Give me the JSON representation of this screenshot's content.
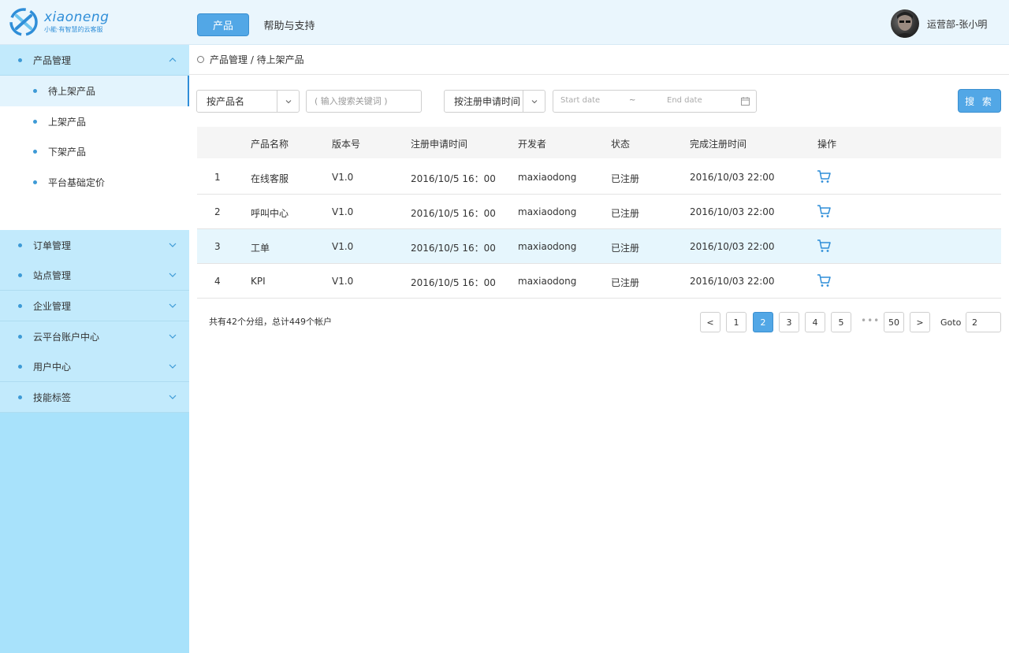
{
  "header": {
    "logo_text": "xiaoneng",
    "logo_slogan": "小能·有智慧的云客服",
    "nav": [
      {
        "label": "产品",
        "active": true
      },
      {
        "label": "帮助与支持",
        "active": false
      }
    ],
    "username": "运营部-张小明"
  },
  "sidebar": {
    "open_group": {
      "label": "产品管理",
      "items": [
        {
          "label": "待上架产品",
          "active": true
        },
        {
          "label": "上架产品",
          "active": false
        },
        {
          "label": "下架产品",
          "active": false
        },
        {
          "label": "平台基础定价",
          "active": false
        }
      ]
    },
    "groups": [
      {
        "label": "订单管理"
      },
      {
        "label": "站点管理"
      },
      {
        "label": "企业管理"
      },
      {
        "label": "云平台账户中心"
      },
      {
        "label": "用户中心"
      },
      {
        "label": "技能标签"
      }
    ]
  },
  "breadcrumb": "产品管理 / 待上架产品",
  "filters": {
    "product_select": "按产品名",
    "keyword_placeholder": "( 输入搜索关键词 )",
    "time_select": "按注册申请时间",
    "start_date_placeholder": "Start date",
    "date_separator": "~",
    "end_date_placeholder": "End date",
    "search_label": "搜 索"
  },
  "table": {
    "columns": [
      "",
      "产品名称",
      "版本号",
      "注册申请时间",
      "开发者",
      "状态",
      "完成注册时间",
      "操作"
    ],
    "rows": [
      {
        "index": "1",
        "name": "在线客服",
        "version": "V1.0",
        "apply_time": "2016/10/5   16：00",
        "developer": "maxiaodong",
        "status": "已注册",
        "done_time": "2016/10/03   22:00",
        "action": "cart-icon",
        "highlighted": false
      },
      {
        "index": "2",
        "name": "呼叫中心",
        "version": "V1.0",
        "apply_time": "2016/10/5   16：00",
        "developer": "maxiaodong",
        "status": "已注册",
        "done_time": "2016/10/03   22:00",
        "action": "cart-icon",
        "highlighted": false
      },
      {
        "index": "3",
        "name": "工单",
        "version": "V1.0",
        "apply_time": "2016/10/5   16：00",
        "developer": "maxiaodong",
        "status": "已注册",
        "done_time": "2016/10/03   22:00",
        "action": "cart-icon",
        "highlighted": true
      },
      {
        "index": "4",
        "name": "KPI",
        "version": "V1.0",
        "apply_time": "2016/10/5   16：00",
        "developer": "maxiaodong",
        "status": "已注册",
        "done_time": "2016/10/03   22:00",
        "action": "cart-icon",
        "highlighted": false
      }
    ]
  },
  "footer": {
    "summary": "共有42个分组，总计449个帐户",
    "pagination": {
      "prev": "<",
      "pages": [
        "1",
        "2",
        "3",
        "4",
        "5"
      ],
      "ellipsis": "•••",
      "last": "50",
      "next": ">",
      "current": "2",
      "goto_label": "Goto",
      "goto_value": "2"
    }
  },
  "colors": {
    "accent": "#52a7e6",
    "header_bg": "#eaf6fd",
    "sidebar_bg": "#a8e2fb",
    "highlight_row": "#e6f6fd"
  }
}
